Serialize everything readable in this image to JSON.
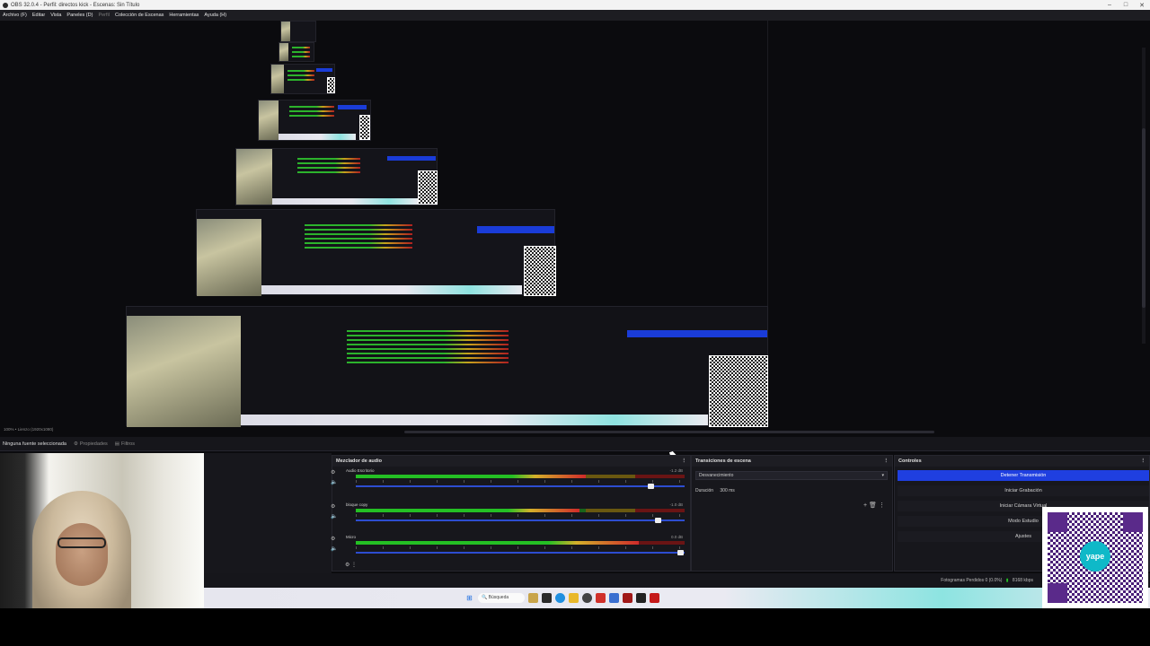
{
  "window": {
    "title": "OBS 32.0.4 - Perfil: directos kick - Escenas: Sin Título",
    "controls": [
      "–",
      "□",
      "✕"
    ]
  },
  "menu": {
    "items": [
      "Archivo (F)",
      "Editar",
      "Vista",
      "Paneles (D)",
      "Perfil",
      "Colección de Escenas",
      "Herramientas",
      "Ayuda (H)"
    ]
  },
  "status_left": "100%  •  Lienzo (1920x1080)",
  "source_bar": {
    "selected_label": "Ninguna fuente seleccionada",
    "properties": "Propiedades",
    "filters": "Filtros"
  },
  "mixer": {
    "title": "Mezclador de audio",
    "channels": [
      {
        "name": "Audio Escritorio",
        "db": "-1.2 dB",
        "level": 0.7,
        "fader": 0.9
      },
      {
        "name": "bloque copy",
        "db": "-1.0 dB",
        "level": 0.68,
        "fader": 0.92
      },
      {
        "name": "Micro",
        "db": "0.0 dB",
        "level": 0.86,
        "fader": 0.99
      }
    ]
  },
  "transitions": {
    "title": "Transiciones de escena",
    "selected": "Desvanecimiento",
    "duration_label": "Duración",
    "duration_value": "300 ms"
  },
  "controls": {
    "title": "Controles",
    "buttons": [
      {
        "label": "Detener Transmisión",
        "active": true
      },
      {
        "label": "Iniciar Grabación",
        "active": false
      },
      {
        "label": "Iniciar Cámara Virtual",
        "active": false
      },
      {
        "label": "Modo Estudio",
        "active": false
      },
      {
        "label": "Ajustes",
        "active": false
      }
    ]
  },
  "status": {
    "dropped": "Fotogramas Perdidos 0 (0.0%)",
    "kbps": "8168 kbps"
  },
  "taskbar": {
    "search": "Búsqueda"
  },
  "qr": {
    "logo_text": "yape"
  },
  "colors": {
    "accent_blue": "#1f3fe0",
    "meter_green": "#24c024",
    "meter_yellow": "#d4b02a",
    "meter_red": "#d02a2a"
  }
}
